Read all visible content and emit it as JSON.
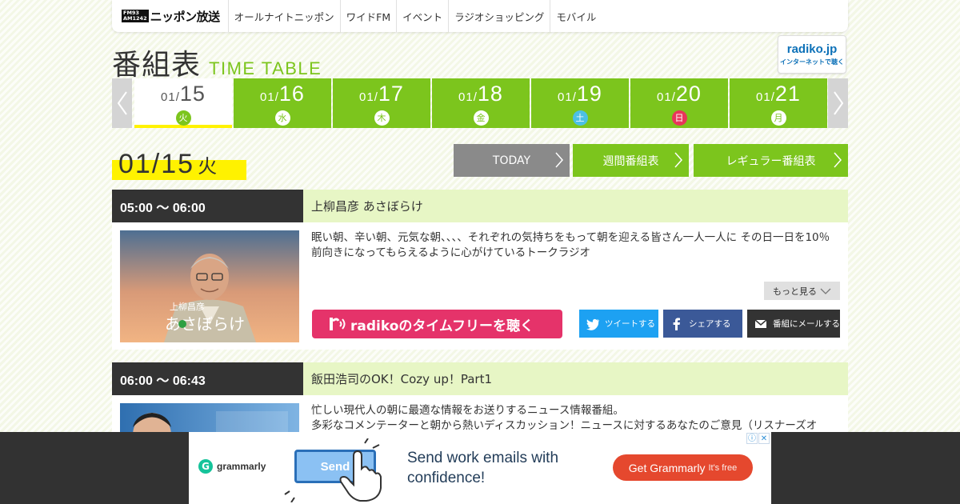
{
  "header": {
    "logo": {
      "freq_fm": "FM93",
      "freq_am": "AM1242",
      "name": "ニッポン放送"
    },
    "nav": [
      "オールナイトニッポン",
      "ワイドFM",
      "イベント",
      "ラジオショッピング",
      "モバイル"
    ]
  },
  "title": {
    "jp": "番組表",
    "en": "TIME TABLE"
  },
  "radiko_badge": {
    "logo": "radiko.jp",
    "sub": "インターネットで聴く"
  },
  "dates": [
    {
      "month": "01/",
      "day": "15",
      "dow": "火"
    },
    {
      "month": "01/",
      "day": "16",
      "dow": "水"
    },
    {
      "month": "01/",
      "day": "17",
      "dow": "木"
    },
    {
      "month": "01/",
      "day": "18",
      "dow": "金"
    },
    {
      "month": "01/",
      "day": "19",
      "dow": "土"
    },
    {
      "month": "01/",
      "day": "20",
      "dow": "日"
    },
    {
      "month": "01/",
      "day": "21",
      "dow": "月"
    }
  ],
  "selected": {
    "date": "01/15",
    "dow": "火"
  },
  "buttons": {
    "today": "TODAY",
    "weekly": "週間番組表",
    "regular": "レギュラー番組表"
  },
  "programs": [
    {
      "time": "05:00 ～ 06:00",
      "title": "上柳昌彦 あさぼらけ",
      "description": "眠い朝、辛い朝、元気な朝、、、、それぞれの気持ちをもって朝を迎える皆さん一人一人に その日一日を10％前向きになってもらえるように心がけているトークラジオ",
      "thumb_caption_small": "上柳昌彦",
      "thumb_caption_large": "あさぼらけ",
      "more": "もっと見る",
      "radiko": "radikoのタイムフリーを聴く",
      "tweet": "ツイートする",
      "share": "シェアする",
      "mail": "番組にメールする"
    },
    {
      "time": "06:00 ～ 06:43",
      "title": "飯田浩司のOK！Cozy up！Part1",
      "description_1": "忙しい現代人の朝に最適な情報をお送りするニュース情報番組。",
      "description_2": "多彩なコメンテーターと朝から熱いディスカッション！ニュースに対するあなたのご意見（リスナーズオ"
    }
  ],
  "ad": {
    "brand": "grammarly",
    "send": "Send",
    "headline_1": "Send work emails with",
    "headline_2": "confidence!",
    "cta": "Get Grammarly",
    "cta_small": "It's free",
    "info": "ⓘ",
    "close": "✕"
  },
  "colors": {
    "green": "#7cc51d",
    "yellow": "#fff200",
    "pink": "#e5336a",
    "dark": "#333333"
  }
}
